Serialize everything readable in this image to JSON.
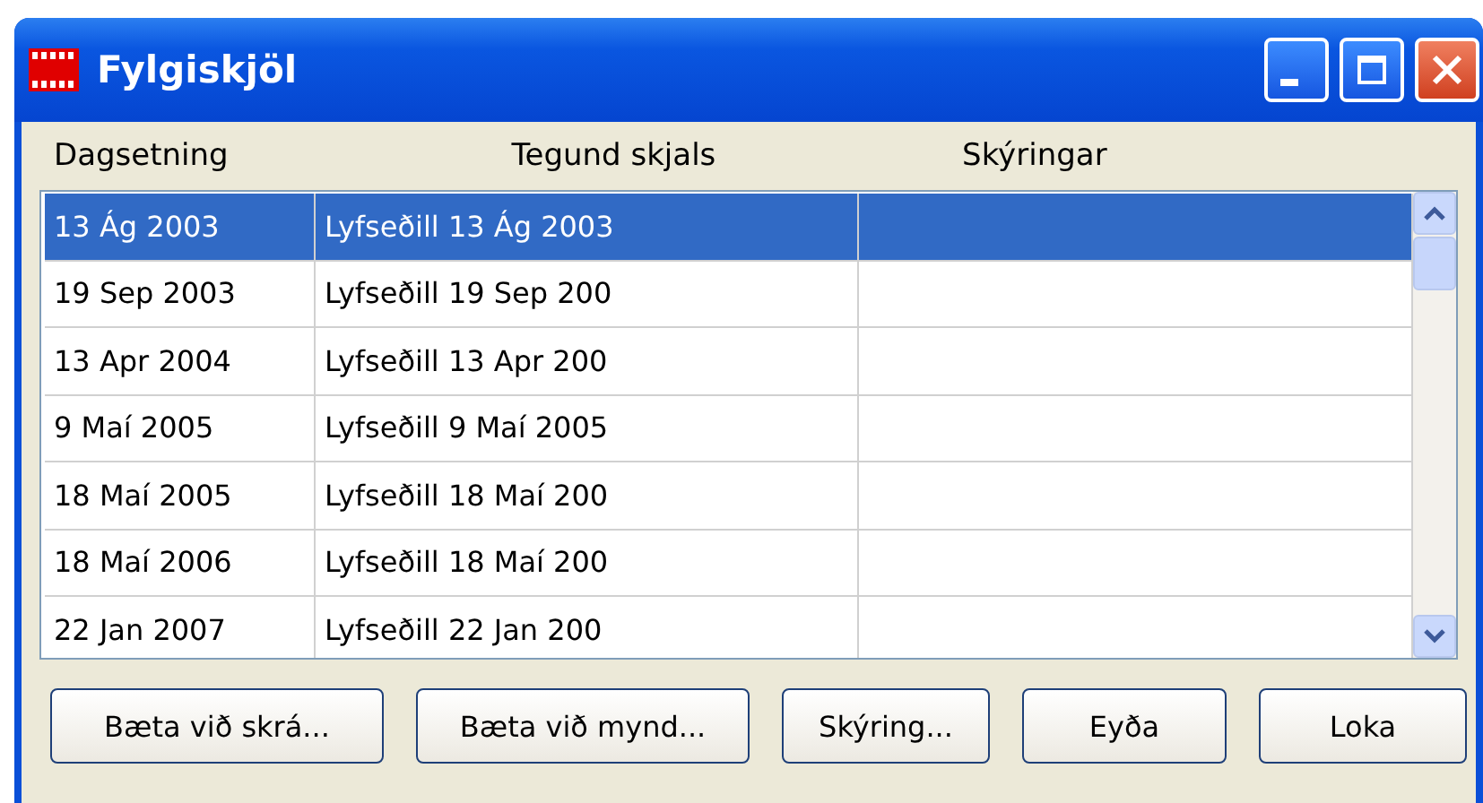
{
  "window": {
    "title": "Fylgiskjöl"
  },
  "table": {
    "columns": [
      "Dagsetning",
      "Tegund skjals",
      "Skýringar"
    ],
    "rows": [
      {
        "date": "13 Ág 2003",
        "type": "Lyfseðill 13 Ág 2003",
        "selected": true
      },
      {
        "date": "19 Sep 2003",
        "type": "Lyfseðill 19 Sep 200",
        "selected": false
      },
      {
        "date": "13 Apr 2004",
        "type": "Lyfseðill 13 Apr 200",
        "selected": false
      },
      {
        "date": "9 Maí 2005",
        "type": "Lyfseðill 9 Maí 2005",
        "selected": false
      },
      {
        "date": "18 Maí 2005",
        "type": "Lyfseðill 18 Maí 200",
        "selected": false
      },
      {
        "date": "18 Maí 2006",
        "type": "Lyfseðill 18 Maí 200",
        "selected": false
      },
      {
        "date": "22 Jan 2007",
        "type": "Lyfseðill 22 Jan 200",
        "selected": false
      }
    ]
  },
  "buttons": [
    "Bæta við skrá...",
    "Bæta við mynd...",
    "Skýring...",
    "Eyða",
    "Loka"
  ]
}
